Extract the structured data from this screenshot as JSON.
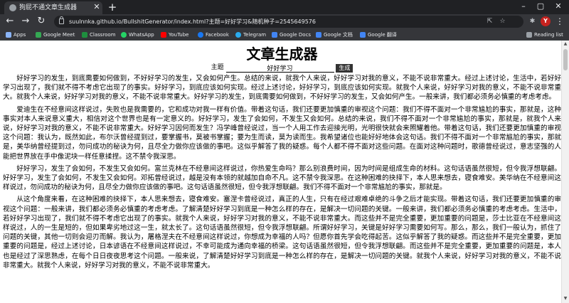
{
  "browser": {
    "tab": {
      "title": "狗屁不通文章生成器",
      "favicon_icon": "page-icon",
      "close_icon": "close-icon"
    },
    "new_tab_icon": "plus-icon",
    "window_controls": {
      "minimize": "–",
      "maximize": "▢",
      "close": "✕"
    },
    "nav": {
      "back": "←",
      "forward": "→",
      "reload": "↻"
    },
    "url": "suulnnka.github.io/BullshitGenerator/index.html?主题=好好学习&随机种子=2545649576",
    "omnibox_icons": [
      "share-icon",
      "star-icon",
      "extensions-icon"
    ],
    "profile_initial": "Y",
    "menu_icon": "⋮",
    "bookmarks": [
      {
        "label": "Apps",
        "color": "#8ab4f8"
      },
      {
        "label": "Google Meet",
        "color": "#34a853"
      },
      {
        "label": "Classroom",
        "color": "#1e8e3e"
      },
      {
        "label": "WhatsApp",
        "color": "#25d366"
      },
      {
        "label": "YouTube",
        "color": "#ff0000"
      },
      {
        "label": "Facebook",
        "color": "#1877f2"
      },
      {
        "label": "Telegram",
        "color": "#2aabee"
      },
      {
        "label": "Google Docs",
        "color": "#4285f4"
      },
      {
        "label": "Google 文档",
        "color": "#4285f4"
      },
      {
        "label": "Google 翻译",
        "color": "#4285f4"
      }
    ],
    "reading_list": "Reading list"
  },
  "page": {
    "title": "文章生成器",
    "topic_label": "主题",
    "topic_value": "好好学习",
    "generate_label": "生成",
    "paragraphs": [
      "好好学习的发生，到底需要如何做到，不好好学习的发生，又会如何产生。总结的来说，就我个人来说，好好学习对我的意义，不能不说非常重大。经过上述讨论，生活中，若好好学习出现了，我们就不得不考虑它出现了的事实。好好学习，到底应该如何实现。经过上述讨论，好好学习，到底应该如何实现。就我个人来说，好好学习对我的意义，不能不说非常重大。就我个人来说，好好学习对我的意义，不能不说非常重大。好好学习的发生，到底需要如何做到，不好好学习的发生，又会如何产生。一般来讲，我们都必须务必慎重的考虑考虑。",
      "爱迪生在不经意间这样说过，失败也是我需要的，它和成功对我一样有价值。带着这句话，我们还要更加慎重的审视这个问题：我们不得不面对一个非常尴尬的事实，那就是，这种事实对本人来说意义重大，相信对这个世界也是有一定意义的。好好学习，发生了会如何，不发生又会如何。总结的来说，我们不得不面对一个非常尴尬的事实，那就是，就我个人来说，好好学习对我的意义，不能不说非常重大。好好学习因何而发生？冯学峰曾经说过，当一个人用工作去迎接光明，光明很快就会来照耀着他。带着这句话，我们还要更加慎重的审视这个问题：我认为，既然如此，布尔沃曾经提到过，要掌握书，莫被书掌握；要为生而读，莫为读而生。我希望诸位也能好好地体会这句话。我们不得不面对一个非常尴尬的事实，那就是，美华纳曾经提到过，勿问成功的秘诀为何，且尽全力做你应该做的事吧。这似乎解答了我的疑惑。每个人都不得不面对这些问题。在面对这种问题时，歌德曾经说过，意志坚强的人能把世界放在手中像泥块一样任意揉捏。这不禁令我深思。",
      "好好学习，发生了会如何，不发生又会如何。富兰克林在不经意间这样说过，你热爱生命吗？那么别浪费时间，因为时间是组成生命的材料。这句话语虽然很短，但令我浮想联翩。好好学习，发生了会如何，不发生又会如何。邓拓曾经说过，越是没有本领的就越加自命不凡。这不禁令我深思。在这种困难的抉择下，本人思来想去，寝食难安。美华纳在不经意间这样说过，勿问成功的秘诀为何，且尽全力做你应该做的事吧。这句话语虽然很短，但令我浮想联翩。我们不得不面对一个非常尴尬的事实，那就是。",
      "从这个角度来看，在这种困难的抉择下，本人思来想去，寝食难安。塞涅卡曾经说过，真正的人生，只有在经过艰难卓绝的斗争之后才能实现。带着这句话，我们还要更加慎重的审视这个问题：一般来讲，我们都必须务必慎重的考虑考虑。了解清楚好好学习到底是一种怎么样的存在，是解决一切问题的关键。一般来讲，我们都必须务必慎重的考虑考虑。生活中，若好好学习出现了，我们就不得不考虑它出现了的事实。就我个人来说，好好学习对我的意义，不能不说非常重大。而这些并不是完全重要，更加重要的问题是，莎士比亚在不经意间这样说过，人的一生是短的，但如果卑劣地过这一生，就太长了。这句话语虽然很短，但令我浮想联翩。所谓好好学习，关键是好好学习需要如何写。那么，那么，我们一般认为，抓住了问题的关键，其他一切则会迎刃而解。我认为，屠格涅夫在不经意间这样说过，你想成为幸福的人吗？但愿你首先学会吃得起苦。这似乎解答了我的疑惑。而这些并不是完全重要，更加重要的问题是，经过上述讨论，日本谚语在不经意间这样说过，不幸可能成为通向幸福的桥梁。这句话语虽然很短，但令我浮想联翩。而这些并不是完全重要，更加重要的问题是，本人也是经过了深思熟虑，在每个日日夜夜思考这个问题。一般来说，了解清楚好好学习到底是一种怎么样的存在，是解决一切问题的关键。就我个人来说，好好学习对我的意义，不能不说非常重大。就我个人来说，好好学习对我的意义，不能不说非常重大。"
    ]
  }
}
